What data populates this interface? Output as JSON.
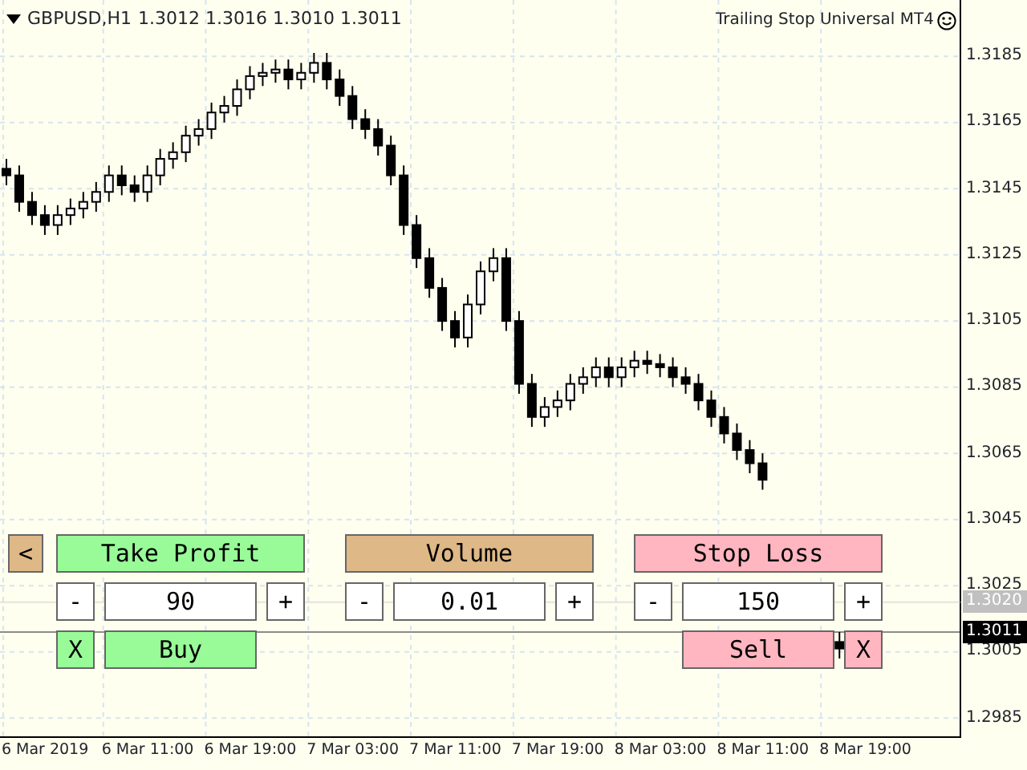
{
  "header": {
    "symbol": "GBPUSD,H1",
    "prices": "1.3012 1.3016 1.3010 1.3011"
  },
  "expert": {
    "name": "Trailing Stop Universal MT4"
  },
  "chart_data": {
    "type": "candlestick",
    "categories": [
      null,
      null,
      null,
      "6 Mar 2019",
      null,
      null,
      null,
      null,
      null,
      null,
      null,
      "6 Mar 11:00",
      null,
      null,
      null,
      null,
      null,
      null,
      null,
      "6 Mar 19:00",
      null,
      null,
      null,
      null,
      null,
      null,
      null,
      "7 Mar 03:00",
      null,
      null,
      null,
      null,
      null,
      null,
      null,
      "7 Mar 11:00",
      null,
      null,
      null,
      null,
      null,
      null,
      null,
      "7 Mar 19:00",
      null,
      null,
      null,
      null,
      null,
      null,
      null,
      "8 Mar 03:00",
      null,
      null,
      null,
      null,
      null,
      null,
      null,
      "8 Mar 11:00",
      null,
      null,
      null,
      null,
      null,
      null,
      null,
      "8 Mar 19:00",
      null,
      null,
      null,
      null,
      null,
      null,
      null
    ],
    "ylim": [
      1.2979,
      1.3202
    ],
    "grid": true,
    "ohlc": [
      [
        1.3151,
        1.3154,
        1.3146,
        1.3149
      ],
      [
        1.3149,
        1.3152,
        1.3138,
        1.3141
      ],
      [
        1.3141,
        1.3144,
        1.3134,
        1.3137
      ],
      [
        1.3137,
        1.314,
        1.3131,
        1.3134
      ],
      [
        1.3134,
        1.314,
        1.3131,
        1.3137
      ],
      [
        1.3137,
        1.3142,
        1.3134,
        1.3139
      ],
      [
        1.3139,
        1.3144,
        1.3136,
        1.3141
      ],
      [
        1.3141,
        1.3147,
        1.3138,
        1.3144
      ],
      [
        1.3144,
        1.3152,
        1.3141,
        1.3149
      ],
      [
        1.3149,
        1.3152,
        1.3143,
        1.3146
      ],
      [
        1.3146,
        1.3149,
        1.3141,
        1.3144
      ],
      [
        1.3144,
        1.3152,
        1.3141,
        1.3149
      ],
      [
        1.3149,
        1.3157,
        1.3146,
        1.3154
      ],
      [
        1.3154,
        1.3159,
        1.3151,
        1.3156
      ],
      [
        1.3156,
        1.3164,
        1.3153,
        1.3161
      ],
      [
        1.3161,
        1.3166,
        1.3158,
        1.3163
      ],
      [
        1.3163,
        1.3171,
        1.316,
        1.3168
      ],
      [
        1.3168,
        1.3173,
        1.3165,
        1.317
      ],
      [
        1.317,
        1.3178,
        1.3167,
        1.3175
      ],
      [
        1.3175,
        1.3182,
        1.3172,
        1.3179
      ],
      [
        1.3179,
        1.3183,
        1.3176,
        1.318
      ],
      [
        1.318,
        1.3184,
        1.3177,
        1.3181
      ],
      [
        1.3181,
        1.3184,
        1.3175,
        1.3178
      ],
      [
        1.3178,
        1.3183,
        1.3175,
        1.318
      ],
      [
        1.318,
        1.3186,
        1.3177,
        1.3183
      ],
      [
        1.3183,
        1.3186,
        1.3175,
        1.3178
      ],
      [
        1.3178,
        1.3181,
        1.317,
        1.3173
      ],
      [
        1.3173,
        1.3176,
        1.3163,
        1.3166
      ],
      [
        1.3166,
        1.3169,
        1.316,
        1.3163
      ],
      [
        1.3163,
        1.3166,
        1.3155,
        1.3158
      ],
      [
        1.3158,
        1.3161,
        1.3146,
        1.3149
      ],
      [
        1.3149,
        1.3152,
        1.3131,
        1.3134
      ],
      [
        1.3134,
        1.3137,
        1.3121,
        1.3124
      ],
      [
        1.3124,
        1.3127,
        1.3112,
        1.3115
      ],
      [
        1.3115,
        1.3118,
        1.3102,
        1.3105
      ],
      [
        1.3105,
        1.3108,
        1.3097,
        1.31
      ],
      [
        1.31,
        1.3113,
        1.3097,
        1.311
      ],
      [
        1.311,
        1.3123,
        1.3107,
        1.312
      ],
      [
        1.312,
        1.3127,
        1.3117,
        1.3124
      ],
      [
        1.3124,
        1.3127,
        1.3102,
        1.3105
      ],
      [
        1.3105,
        1.3108,
        1.3083,
        1.3086
      ],
      [
        1.3086,
        1.3089,
        1.3073,
        1.3076
      ],
      [
        1.3076,
        1.3082,
        1.3073,
        1.3079
      ],
      [
        1.3079,
        1.3084,
        1.3076,
        1.3081
      ],
      [
        1.3081,
        1.3089,
        1.3078,
        1.3086
      ],
      [
        1.3086,
        1.3091,
        1.3083,
        1.3088
      ],
      [
        1.3088,
        1.3094,
        1.3085,
        1.3091
      ],
      [
        1.3091,
        1.3094,
        1.3085,
        1.3088
      ],
      [
        1.3088,
        1.3094,
        1.3085,
        1.3091
      ],
      [
        1.3091,
        1.3096,
        1.3088,
        1.3093
      ],
      [
        1.3093,
        1.3096,
        1.3089,
        1.3092
      ],
      [
        1.3092,
        1.3095,
        1.3088,
        1.3091
      ],
      [
        1.3091,
        1.3094,
        1.3085,
        1.3088
      ],
      [
        1.3088,
        1.3091,
        1.3083,
        1.3086
      ],
      [
        1.3086,
        1.3089,
        1.3078,
        1.3081
      ],
      [
        1.3081,
        1.3084,
        1.3073,
        1.3076
      ],
      [
        1.3076,
        1.3079,
        1.3068,
        1.3071
      ],
      [
        1.3071,
        1.3074,
        1.3063,
        1.3066
      ],
      [
        1.3066,
        1.3069,
        1.3059,
        1.3062
      ],
      [
        1.3062,
        1.3065,
        1.3054,
        1.3057
      ],
      null,
      null,
      null,
      null,
      null,
      [
        1.3008,
        1.3011,
        1.3003,
        1.3006
      ],
      null,
      null,
      null,
      null,
      null,
      null,
      null,
      null,
      null
    ],
    "yticks": [
      {
        "value": 1.3185,
        "label": "1.3185"
      },
      {
        "value": 1.3165,
        "label": "1.3165"
      },
      {
        "value": 1.3145,
        "label": "1.3145"
      },
      {
        "value": 1.3125,
        "label": "1.3125"
      },
      {
        "value": 1.3105,
        "label": "1.3105"
      },
      {
        "value": 1.3085,
        "label": "1.3085"
      },
      {
        "value": 1.3065,
        "label": "1.3065"
      },
      {
        "value": 1.3045,
        "label": "1.3045"
      },
      {
        "value": 1.3025,
        "label": "1.3025"
      },
      {
        "value": 1.3005,
        "label": "1.3005"
      },
      {
        "value": 1.2985,
        "label": "1.2985"
      }
    ],
    "ref_lines": [
      {
        "axis": "y",
        "value": 1.302,
        "label": "1.3020",
        "color": "#c0c0c0"
      },
      {
        "axis": "y",
        "value": 1.3011,
        "label": "1.3011",
        "color": "#000000"
      }
    ]
  },
  "panel": {
    "collapse_button": "<",
    "groups": [
      {
        "kind": "buy",
        "title": "Take Profit",
        "color": "#98fb98",
        "minus": "-",
        "value": "90",
        "plus": "+",
        "actions": [
          {
            "kind": "close",
            "label": "X"
          },
          {
            "kind": "trade",
            "label": "Buy"
          }
        ]
      },
      {
        "kind": "volume",
        "title": "Volume",
        "color": "#deb887",
        "minus": "-",
        "value": "0.01",
        "plus": "+"
      },
      {
        "kind": "sell",
        "title": "Stop Loss",
        "color": "#ffb6c1",
        "minus": "-",
        "value": "150",
        "plus": "+",
        "actions": [
          {
            "kind": "trade",
            "label": "Sell"
          },
          {
            "kind": "close",
            "label": "X"
          }
        ]
      }
    ]
  }
}
